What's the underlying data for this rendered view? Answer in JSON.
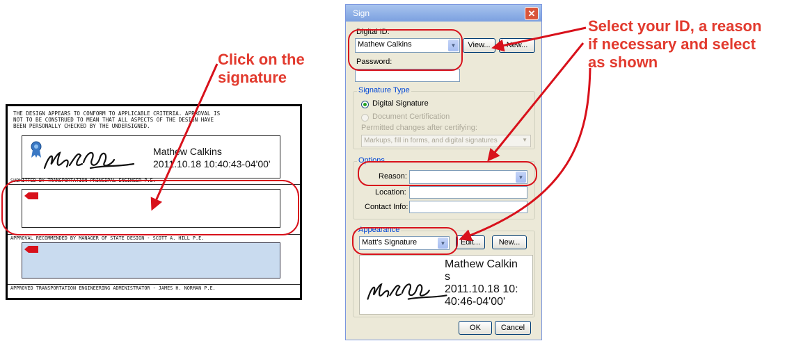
{
  "document": {
    "header_lines": [
      "THE DESIGN APPEARS TO CONFORM TO APPLICABLE CRITERIA. APPROVAL IS",
      "NOT TO BE CONSTRUED TO MEAN THAT ALL ASPECTS OF THE DESIGN HAVE",
      "BEEN PERSONALLY CHECKED BY THE UNDERSIGNED."
    ],
    "signer_name": "Mathew Calkins",
    "signer_timestamp": "2011.10.18 10:40:43-04'00'",
    "section1_label": "SUBMITTED BY TRANSPORTATION PRINCIPAL ENGINEER P.E.",
    "section2_label": "APPROVAL RECOMMENDED BY MANAGER OF STATE DESIGN - SCOTT A. HILL P.E.",
    "section3_label": "APPROVED TRANSPORTATION ENGINEERING ADMINISTRATOR - JAMES H. NORMAN P.E."
  },
  "callouts": {
    "left_line1": "Click on the",
    "left_line2": "signature",
    "right_line1": "Select your ID, a reason",
    "right_line2": "if necessary and select",
    "right_line3": "as shown"
  },
  "dialog": {
    "title": "Sign",
    "digital_id_label": "Digital ID:",
    "digital_id_value": "Mathew Calkins",
    "view_button": "View...",
    "new_button": "New...",
    "password_label": "Password:",
    "password_value": "",
    "signature_type_group": "Signature Type",
    "digital_signature_option": "Digital Signature",
    "document_certification_option": "Document Certification",
    "permitted_changes_label": "Permitted changes after certifying:",
    "permitted_changes_value": "Markups, fill in forms, and digital signatures",
    "options_group": "Options",
    "reason_label": "Reason:",
    "reason_value": "",
    "location_label": "Location:",
    "location_value": "",
    "contact_label": "Contact Info:",
    "contact_value": "",
    "appearance_group": "Appearance",
    "appearance_value": "Matt's Signature",
    "edit_button": "Edit...",
    "appearance_new_button": "New...",
    "preview_name_line1": "Mathew Calkin",
    "preview_name_line2": "s",
    "preview_date_line1": "2011.10.18 10:",
    "preview_date_line2": "40:46-04'00'",
    "ok_button": "OK",
    "cancel_button": "Cancel"
  },
  "colors": {
    "callout_red": "#e23a2e",
    "oval_red": "#d8111b",
    "title_bar": "#7ba0e0",
    "dialog_bg": "#ece9d8",
    "sig_field_blue": "#c9dbef"
  }
}
